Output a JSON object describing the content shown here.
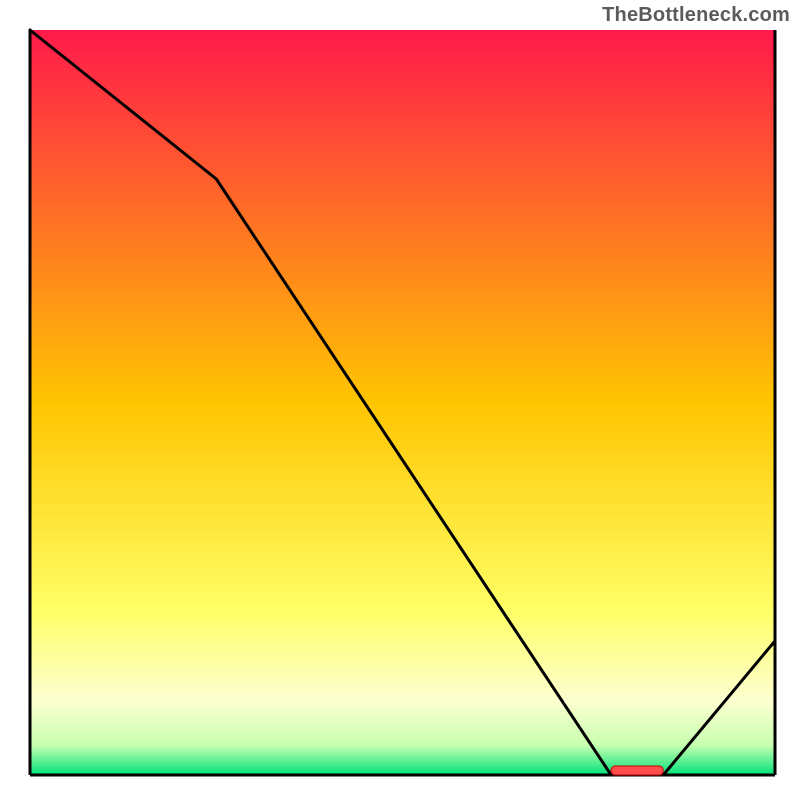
{
  "attribution": "TheBottleneck.com",
  "chart_data": {
    "type": "line",
    "title": "",
    "xlabel": "",
    "ylabel": "",
    "xlim": [
      0,
      100
    ],
    "ylim": [
      0,
      100
    ],
    "x": [
      0,
      25,
      78,
      85,
      100
    ],
    "values": [
      100,
      80,
      0,
      0,
      18
    ],
    "optimum_band": {
      "x_start": 78,
      "x_end": 85
    },
    "background_gradient": {
      "stops": [
        {
          "offset": 0.0,
          "color": "#ff1a4b"
        },
        {
          "offset": 0.5,
          "color": "#ffc500"
        },
        {
          "offset": 0.78,
          "color": "#ffff66"
        },
        {
          "offset": 0.9,
          "color": "#fdffd0"
        },
        {
          "offset": 0.96,
          "color": "#c7ffb0"
        },
        {
          "offset": 1.0,
          "color": "#00e27a"
        }
      ]
    }
  }
}
